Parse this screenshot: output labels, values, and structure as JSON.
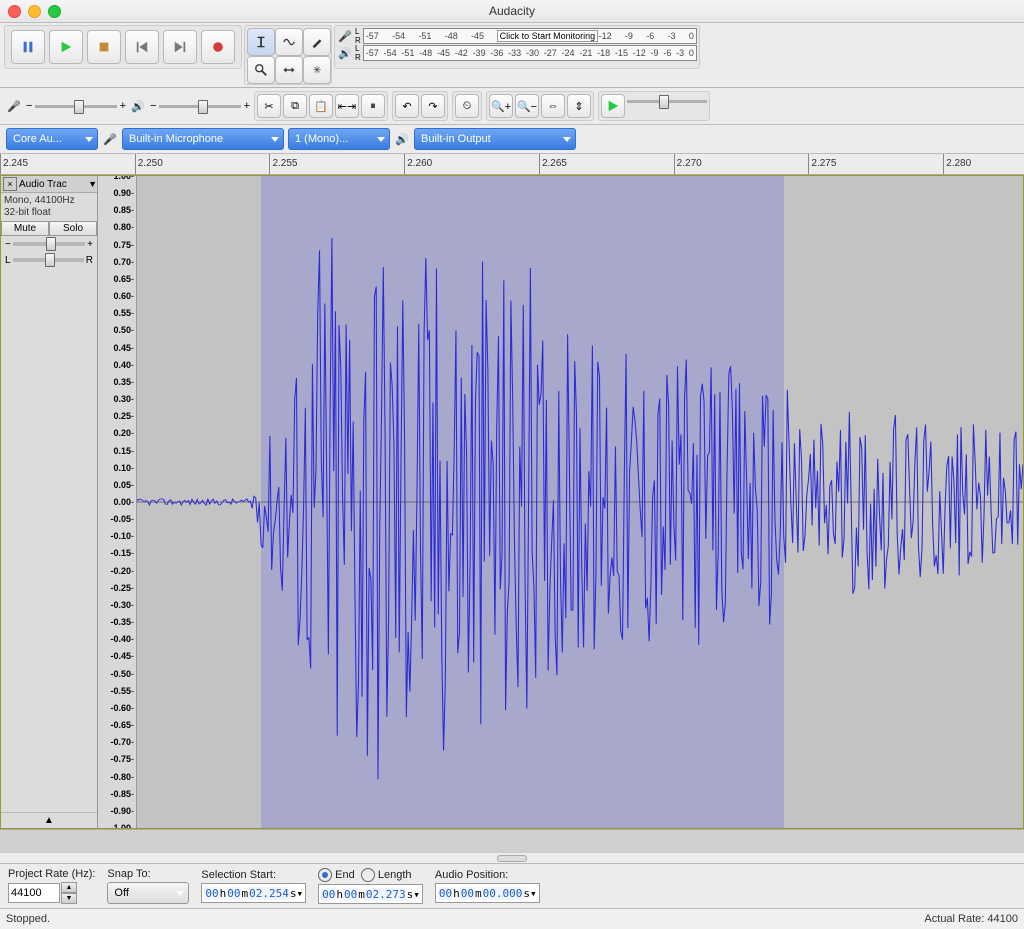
{
  "window_title": "Audacity",
  "meter_ticks": [
    "-57",
    "-54",
    "-51",
    "-48",
    "-45",
    "-42"
  ],
  "meter_click": "Click to Start Monitoring",
  "meter_ticks2": [
    "-18",
    "-15",
    "-12",
    "-9",
    "-6",
    "-3",
    "0"
  ],
  "play_ticks": [
    "-57",
    "-54",
    "-51",
    "-48",
    "-45",
    "-42",
    "-39",
    "-36",
    "-33",
    "-30",
    "-27",
    "-24",
    "-21",
    "-18",
    "-15",
    "-12",
    "-9",
    "-6",
    "-3",
    "0"
  ],
  "devices": {
    "host": "Core Au...",
    "rec_device": "Built-in Microphone",
    "rec_channels": "1 (Mono)...",
    "play_device": "Built-in Output"
  },
  "timeline": {
    "start": 2.245,
    "end": 2.283,
    "ticks": [
      "2.245",
      "2.250",
      "2.255",
      "2.260",
      "2.265",
      "2.270",
      "2.275",
      "2.280"
    ]
  },
  "selection_frac": {
    "start": 0.14,
    "end": 0.73
  },
  "track": {
    "name": "Audio Trac",
    "info1": "Mono, 44100Hz",
    "info2": "32-bit float",
    "mute": "Mute",
    "solo": "Solo"
  },
  "vscale": [
    "1.00",
    "0.90",
    "0.85",
    "0.80",
    "0.75",
    "0.70",
    "0.65",
    "0.60",
    "0.55",
    "0.50",
    "0.45",
    "0.40",
    "0.35",
    "0.30",
    "0.25",
    "0.20",
    "0.15",
    "0.10",
    "0.05",
    "0.00",
    "-0.05",
    "-0.10",
    "-0.15",
    "-0.20",
    "-0.25",
    "-0.30",
    "-0.35",
    "-0.40",
    "-0.45",
    "-0.50",
    "-0.55",
    "-0.60",
    "-0.65",
    "-0.70",
    "-0.75",
    "-0.80",
    "-0.85",
    "-0.90",
    "-1.00"
  ],
  "footer": {
    "project_rate_label": "Project Rate (Hz):",
    "project_rate": "44100",
    "snap_label": "Snap To:",
    "snap_value": "Off",
    "sel_start_label": "Selection Start:",
    "end_label": "End",
    "length_label": "Length",
    "sel_start": {
      "h": "00",
      "m": "00",
      "s": "02.254"
    },
    "sel_end": {
      "h": "00",
      "m": "00",
      "s": "02.273"
    },
    "audio_pos_label": "Audio Position:",
    "audio_pos": {
      "h": "00",
      "m": "00",
      "s": "00.000"
    }
  },
  "status_left": "Stopped.",
  "status_right": "Actual Rate: 44100"
}
